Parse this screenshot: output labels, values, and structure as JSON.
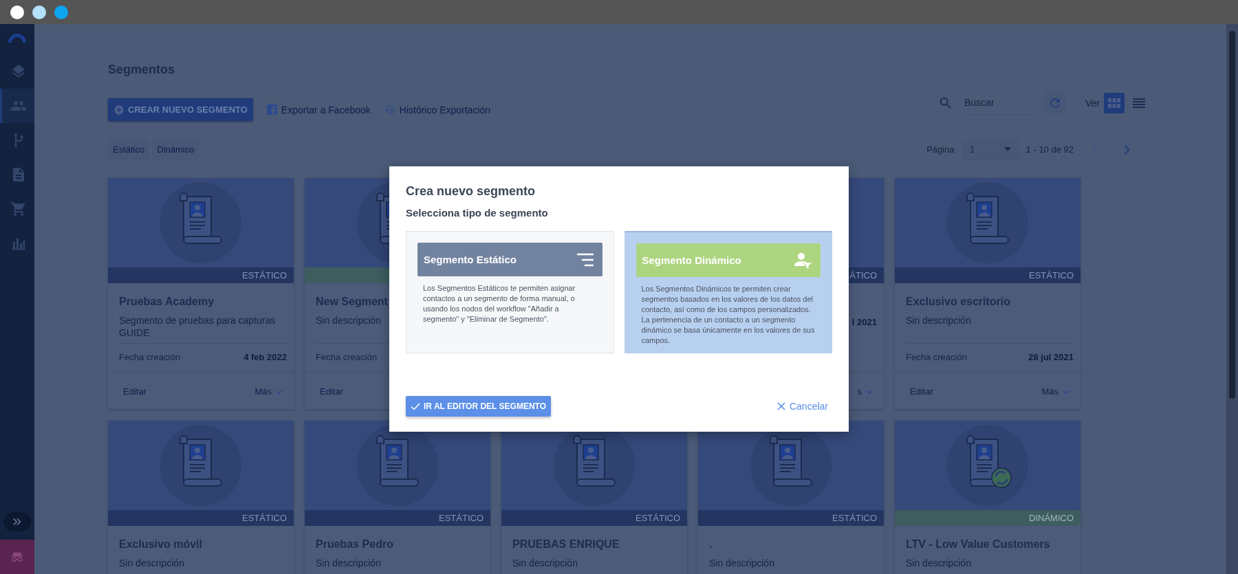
{
  "sidebar": {
    "items": [
      {
        "selected": false
      },
      {
        "selected": true
      },
      {
        "selected": false
      },
      {
        "selected": false
      },
      {
        "selected": false
      },
      {
        "selected": false
      }
    ]
  },
  "page": {
    "title": "Segmentos"
  },
  "toolbar": {
    "create_button": "CREAR NUEVO SEGMENTO",
    "links": [
      "Exportar a Facebook",
      "Histórico Exportación"
    ]
  },
  "search": {
    "placeholder": "Buscar"
  },
  "view": {
    "label": "Ver",
    "options": [
      {
        "selected": true
      },
      {
        "selected": false
      }
    ]
  },
  "filter_tabs": [
    "Estático",
    "Dinámico"
  ],
  "pagination": {
    "label": "Página",
    "page": "1",
    "range": "1 - 10 de 92",
    "previous_disabled": true,
    "next_disabled": false
  },
  "cards": [
    {
      "kind": "static",
      "badge": "ESTÁTICO",
      "title": "Pruebas Academy",
      "description": "Segmento de pruebas para capturas GUIDE",
      "date_label": "Fecha creación",
      "date": "4 feb 2022",
      "edit": "Editar",
      "more": "Más"
    },
    {
      "kind": "dynamic",
      "title": "New Segment",
      "description": "Sin descripción",
      "date_label": "Fecha creación",
      "edit": "Editar"
    },
    {
      "kind": "static",
      "badge": "ÁTICO",
      "date": "l 2021",
      "more": "s"
    },
    {
      "kind": "static",
      "badge": "ESTÁTICO",
      "title": "Exclusivo escritorio",
      "description": "Sin descripción",
      "date_label": "Fecha creación",
      "date": "28 jul 2021",
      "edit": "Editar",
      "more": "Más"
    },
    {
      "kind": "static",
      "badge": "ESTÁTICO",
      "title": "Exclusivo móvil",
      "description": "Sin descripción"
    },
    {
      "kind": "static",
      "badge": "ESTÁTICO",
      "title": "Pruebas Pedro",
      "description": "Sin descripción"
    },
    {
      "kind": "static",
      "badge": "ESTÁTICO",
      "title": "PRUEBAS ENRIQUE",
      "description": "Sin descripción"
    },
    {
      "kind": "static",
      "badge": "ESTÁTICO",
      "title": ".",
      "description": "Sin descripción"
    },
    {
      "kind": "dynamic",
      "badge": "DINÁMICO",
      "title": "LTV - Low Value Customers",
      "description": "Sin descripción"
    }
  ],
  "modal": {
    "title": "Crea nuevo segmento",
    "subtitle": "Selecciona tipo de segmento",
    "options": [
      {
        "kind": "static",
        "title": "Segmento Estático",
        "description": "Los Segmentos Estáticos te permiten asignar contactos a un segmento de forma manual, o usando los nodos del workflow \"Añadir a segmento\" y \"Eliminar de Segmento\".",
        "selected": false
      },
      {
        "kind": "dynamic",
        "title": "Segmento Dinámico",
        "description": "Los Segmentos Dinámicos te permiten crear segmentos basados en los valores de los datos del contacto, así como de los campos personalizados. La pertenencia de un contacto a un segmento dinámico se basa únicamente en los valores de sus campos.",
        "selected": true
      }
    ],
    "confirm_button": "IR AL EDITOR DEL SEGMENTO",
    "cancel_button": "Cancelar"
  }
}
